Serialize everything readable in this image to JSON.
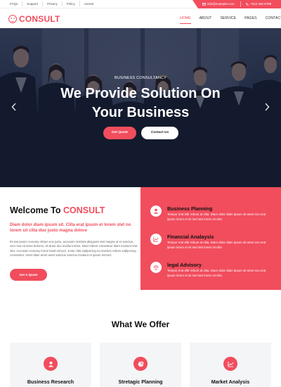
{
  "topbar": {
    "links": [
      "FAQs",
      "Support",
      "Privacy",
      "Policy",
      "Career"
    ],
    "email": "info@example.com",
    "phone": "+012 345 6789"
  },
  "brand": {
    "name": "CONSULT"
  },
  "nav": {
    "items": [
      "HOME",
      "ABOUT",
      "SERVICE",
      "PAGES",
      "CONTACT"
    ],
    "active": "HOME"
  },
  "hero": {
    "kicker": "BUSINESS CONSULTANCY",
    "title_line1": "We Provide Solution On",
    "title_line2": "Your Business",
    "primary_button": "Get Quote",
    "secondary_button": "Contact Us"
  },
  "welcome": {
    "title_prefix": "Welcome To ",
    "title_accent": "CONSULT",
    "lead": "Diam dolor diam ipsum sit. Clita erat ipsum et lorem stet no lorem sit clita duo justo magna dolore",
    "body": "Et stet ipsum nonumy rebum eos justo, accusam invidunt aliquyam stet magna at et sanctus, vero sea sit amet dolores, sit dolor duo invidunt dolor, kasd rebum consetetur diam invidunt erat stet. Accusam nonumy lorem kasd eirmod. Justo clita sadipscing ea invidunt rebum sadipscing consetetur. Amet diam amet amet sanctus sanctus invidunt et ipsum eirmod.",
    "button": "Get A Quote"
  },
  "features": [
    {
      "title": "Business Planning",
      "text": "Tempor erat elitr rebum at clita. Diam dolor diam ipsum sit amet eos erat ipsum lorem et sit sed stet lorem sit clita",
      "icon": "user-icon"
    },
    {
      "title": "Financial Analaysis",
      "text": "Tempor erat elitr rebum at clita. Diam dolor diam ipsum sit amet eos erat ipsum lorem et sit sed stet lorem sit clita",
      "icon": "chart-icon"
    },
    {
      "title": "legal Advisory",
      "text": "Tempor erat elitr rebum at clita. Diam dolor diam ipsum sit amet eos erat ipsum lorem et sit sed stet lorem sit clita",
      "icon": "balance-icon"
    }
  ],
  "offer": {
    "title": "What We Offer",
    "cards": [
      {
        "label": "Business Research",
        "icon": "user-icon"
      },
      {
        "label": "Stretagic Planning",
        "icon": "pie-chart-icon"
      },
      {
        "label": "Market Analysis",
        "icon": "line-chart-icon"
      }
    ]
  },
  "colors": {
    "accent": "#f14d5d",
    "dark": "#111111",
    "hero_overlay": "#0e1630"
  }
}
